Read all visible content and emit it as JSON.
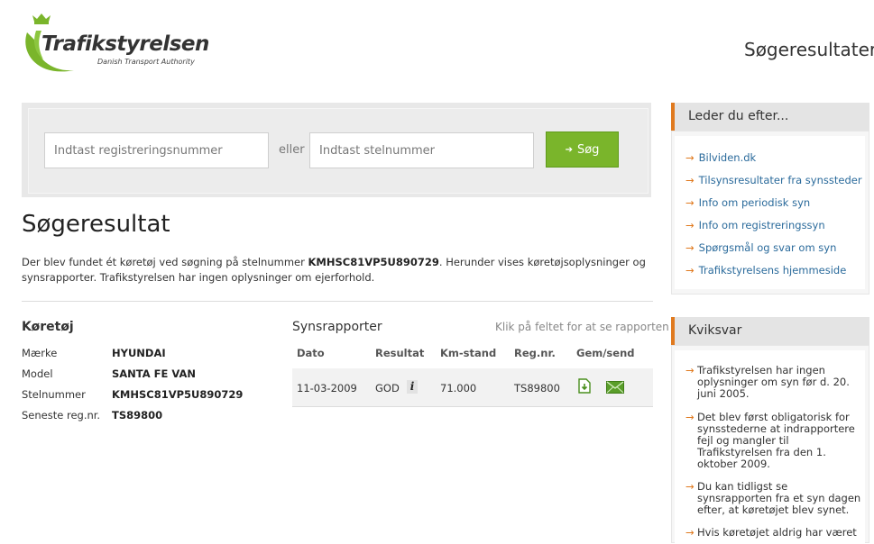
{
  "header": {
    "logo_title": "Trafikstyrelsen",
    "logo_subtitle": "Danish Transport Authority",
    "page_heading": "Søgeresultater"
  },
  "search": {
    "reg_placeholder": "Indtast registreringsnummer",
    "or_label": "eller",
    "stel_placeholder": "Indtast stelnummer",
    "button_label": "Søg",
    "button_icon": "arrow-right-icon"
  },
  "results": {
    "title": "Søgeresultat",
    "desc_prefix": "Der blev fundet ét køretøj ved søgning på stelnummer ",
    "desc_vin": "KMHSC81VP5U890729",
    "desc_suffix": ". Herunder vises køretøjsoplysninger og synsrapporter. Trafikstyrelsen har ingen oplysninger om ejerforhold."
  },
  "vehicle": {
    "heading": "Køretøj",
    "rows": [
      {
        "label": "Mærke",
        "value": "HYUNDAI"
      },
      {
        "label": "Model",
        "value": "SANTA FE VAN"
      },
      {
        "label": "Stelnummer",
        "value": "KMHSC81VP5U890729"
      },
      {
        "label": "Seneste reg.nr.",
        "value": "TS89800"
      }
    ]
  },
  "reports": {
    "heading": "Synsrapporter",
    "hint": "Klik på feltet for at se rapporten",
    "columns": [
      "Dato",
      "Resultat",
      "Km-stand",
      "Reg.nr.",
      "Gem/send"
    ],
    "rows": [
      {
        "date": "11-03-2009",
        "result": "GOD",
        "km": "71.000",
        "reg": "TS89800",
        "icons": [
          "info-icon",
          "save-document-icon",
          "email-icon"
        ]
      }
    ]
  },
  "sidebar": {
    "looking_heading": "Leder du efter...",
    "links": [
      "Bilviden.dk",
      "Tilsynsresultater fra synssteder",
      "Info om periodisk syn",
      "Info om registreringssyn",
      "Spørgsmål og svar om syn",
      "Trafikstyrelsens hjemmeside"
    ],
    "quick_heading": "Kviksvar",
    "quick_items": [
      "Trafikstyrelsen har ingen oplysninger om syn før d. 20. juni 2005.",
      "Det blev først obligatorisk for synsstederne at indrapportere fejl og mangler til Trafikstyrelsen fra den 1. oktober 2009.",
      "Du kan tidligst se synsrapporten fra et syn dagen efter, at køretøjet blev synet.",
      "Hvis køretøjet aldrig har været"
    ]
  },
  "colors": {
    "brand_green": "#7ab52b",
    "accent_orange": "#e07a1f",
    "link_blue": "#2a6a9b"
  }
}
